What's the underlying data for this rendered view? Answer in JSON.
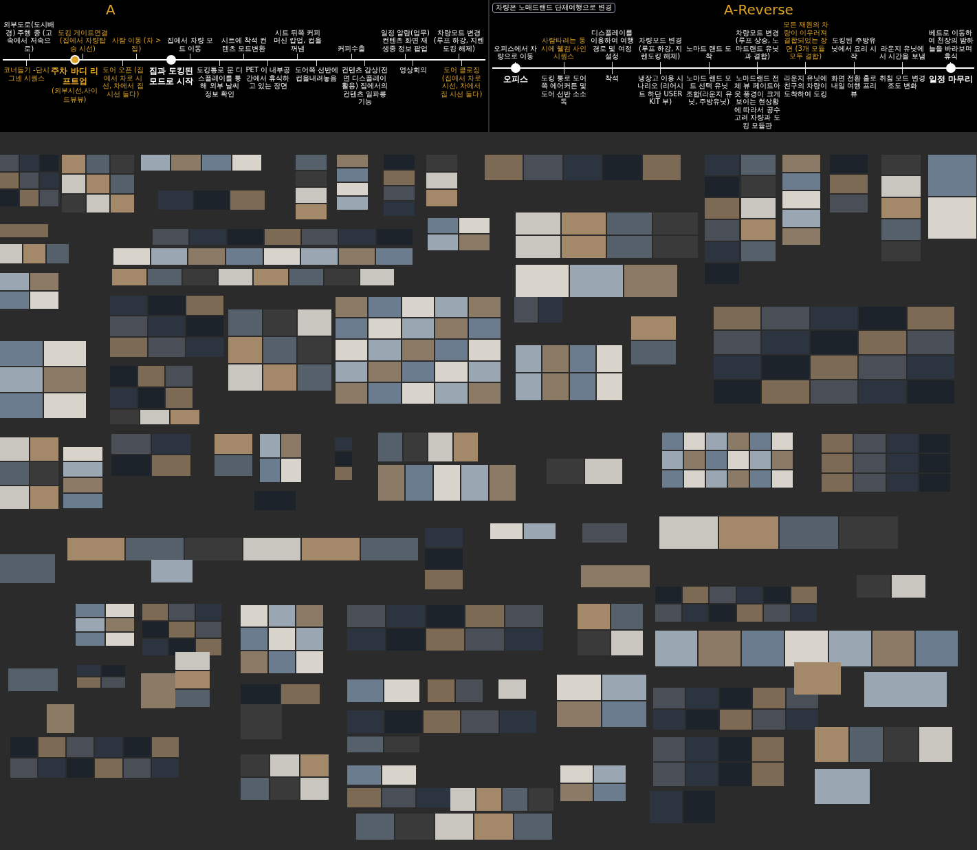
{
  "timelines": [
    {
      "section_label": "A",
      "above": [
        {
          "text": "외부도로(도시배경) 주행 중 (고속에서 저속으로)",
          "highlight": false
        },
        {
          "text": "도킹 게이트연결 (집에서 차량탑승 시선)",
          "highlight": true
        },
        {
          "text": "사람 이동 (차 > 집)",
          "highlight": true
        },
        {
          "text": "집에서 차량 모드 이동",
          "highlight": false
        },
        {
          "text": "시트에 착석 컨텐츠 모드변환",
          "highlight": false
        },
        {
          "text": "시트 뒤쪽 커피머신 캅업, 컵을 꺼냄",
          "highlight": false
        },
        {
          "text": "커피수출",
          "highlight": false
        },
        {
          "text": "일정 알람(업무) 컨텐츠 화면 재생중 정보 팝업",
          "highlight": false
        },
        {
          "text": "차량모드 변경(루프 하강, 지렌도킹 해제)",
          "highlight": false
        }
      ],
      "below": [
        {
          "kind": "note",
          "text": "코너돌기 -단시그넨 시퀀스",
          "highlight": true
        },
        {
          "kind": "milestone",
          "text": "주차 바디 리프트업",
          "sub": "(외부시선,사이드뷰뷰)",
          "highlight": true
        },
        {
          "kind": "note",
          "text": "도어 오픈 (집에서 차로 시선, 차에서 집 시선 둘다)",
          "highlight": true
        },
        {
          "kind": "milestone",
          "text": "집과 도킹된 모드로 시작",
          "highlight": false
        },
        {
          "kind": "note",
          "text": "도킹통로 문 디스플레이를 통해 외부 날씨 정보 확인",
          "highlight": false
        },
        {
          "kind": "note",
          "text": "PET 이 내부공간에서 휴식하고 있는 장면",
          "highlight": false
        },
        {
          "kind": "note",
          "text": "도어쪽 선반에 컵을내려놓음",
          "highlight": false
        },
        {
          "kind": "note",
          "text": "컨텐츠 감상(전면 디스플레이 활용) 집에서의 컨텐츠 일파롱 기능",
          "highlight": false
        },
        {
          "kind": "note",
          "text": "영상회의",
          "highlight": false
        },
        {
          "kind": "note",
          "text": "도어 클로징 (집에서 차로 시선, 차에서 집 시선 둘다)",
          "highlight": true
        }
      ]
    },
    {
      "section_label": "A-Reverse",
      "note_box": "차량은 노매드랜드 단체여행으로 변경",
      "above": [
        {
          "text": "오피스에서 차량으로 이동",
          "highlight": false
        },
        {
          "text": "사람타려는 동시에 웰컴 사인 시퀀스",
          "highlight": true
        },
        {
          "text": "디스플레이를 이용하여 여행 경로 및 여정 설정",
          "highlight": false
        },
        {
          "text": "차량모드 변경(루프 하강, 지렌도킹 해제)",
          "highlight": false
        },
        {
          "text": "노마드 랜드 도착",
          "highlight": false
        },
        {
          "text": "차량모드 변경(루프 상승, 노마드랜드 유닛과 결합)",
          "highlight": false
        },
        {
          "text": "모든 재원의 차량이 이우러져 결합되있는 장면 (3개 모듈 모두 결합)",
          "highlight": true
        },
        {
          "text": "도킹된 주방유닛에서 요리 시작",
          "highlight": false
        },
        {
          "text": "라운지 유닛에서 시간을 보냄",
          "highlight": false
        },
        {
          "text": "베드로 이동하여 천장의 밤하늘을 바라보며 휴식",
          "highlight": false
        }
      ],
      "below": [
        {
          "kind": "milestone",
          "text": "오피스",
          "highlight": false
        },
        {
          "kind": "note",
          "text": "도킹 통로 도어쪽 에어커튼 및 도어 선반 소소독",
          "highlight": false
        },
        {
          "kind": "note",
          "text": "착석",
          "highlight": false
        },
        {
          "kind": "note",
          "text": "냉장고 이용 시나리오 (리어시트 하단 USER KIT 부)",
          "highlight": false
        },
        {
          "kind": "note",
          "text": "노마드 랜드 모드 선택 유닛 조합(라운지 유닛, 주방유닛)",
          "highlight": false
        },
        {
          "kind": "note",
          "text": "노마드랜드 전체 뷰 페이드아웃 풍경이 크게 보이는 현상황에 따라서 공수 고려 차량과 도킹 모듈판",
          "highlight": false
        },
        {
          "kind": "note",
          "text": "라운지 유닛에 친구의 차량이 도착하여 도킹",
          "highlight": false
        },
        {
          "kind": "note",
          "text": "화면 전환 홀로 내일 여행 프리뷰",
          "highlight": false
        },
        {
          "kind": "note",
          "text": "취침 모드 변경 조도 변화",
          "highlight": false
        },
        {
          "kind": "milestone",
          "text": "일정 마무리",
          "highlight": false
        }
      ]
    }
  ]
}
